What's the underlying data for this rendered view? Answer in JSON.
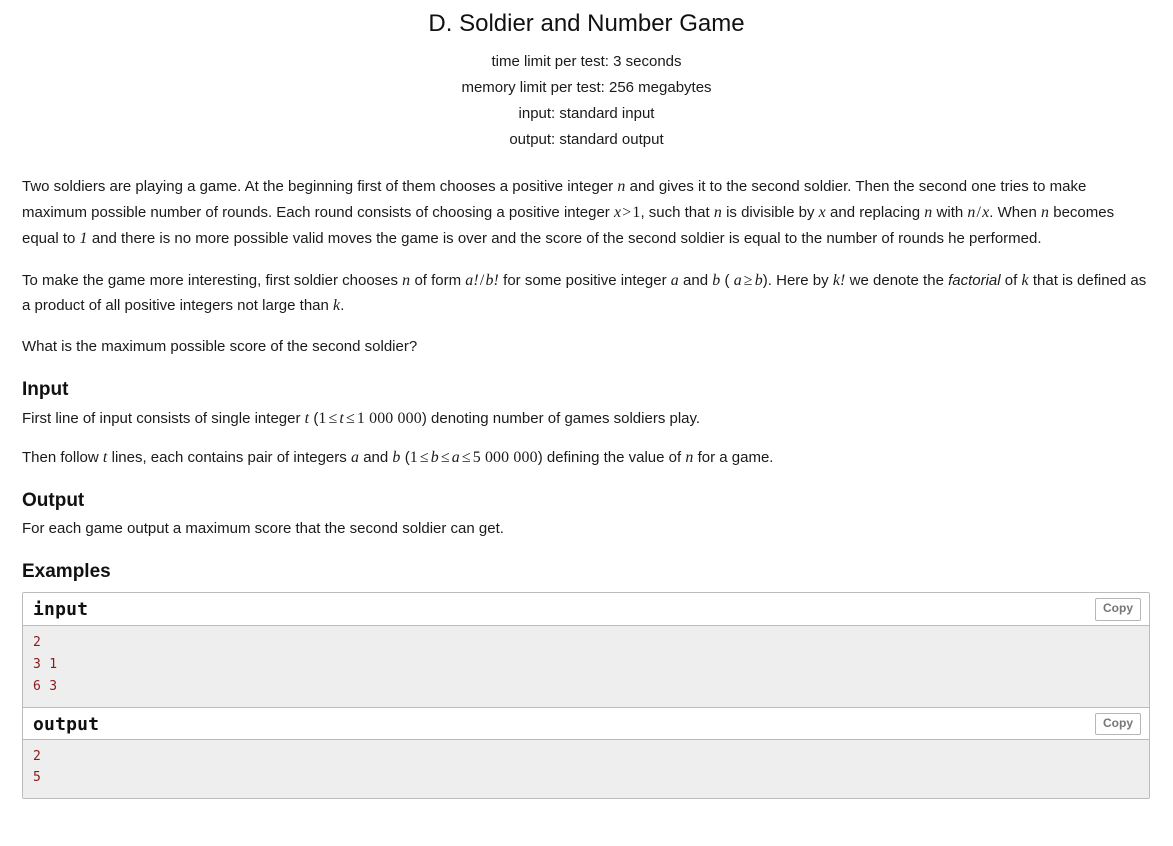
{
  "header": {
    "title": "D. Soldier and Number Game",
    "time_limit": "time limit per test: 3 seconds",
    "memory_limit": "memory limit per test: 256 megabytes",
    "input_spec": "input: standard input",
    "output_spec": "output: standard output"
  },
  "legend": {
    "p1": {
      "t1": "Two soldiers are playing a game. At the beginning first of them chooses a positive integer ",
      "m1": "n",
      "t2": " and gives it to the second soldier. Then the second one tries to make maximum possible number of rounds. Each round consists of choosing a positive integer ",
      "m2_var": "x",
      "m2_op": ">",
      "m2_num": "1",
      "t3": ", such that ",
      "m3": "n",
      "t4": " is divisible by ",
      "m4": "x",
      "t5": " and replacing ",
      "m5": "n",
      "t6": " with ",
      "m6_a": "n",
      "m6_slash": "/",
      "m6_b": "x",
      "t7": ". When ",
      "m7": "n",
      "t8": " becomes equal to ",
      "m8": "1",
      "t9": " and there is no more possible valid moves the game is over and the score of the second soldier is equal to the number of rounds he performed."
    },
    "p2": {
      "t1": "To make the game more interesting, first soldier chooses ",
      "m1": "n",
      "t2": " of form ",
      "m2": "a!",
      "m2_slash": "/",
      "m2b": "b!",
      "t3": " for some positive integer ",
      "m3": "a",
      "t4": " and ",
      "m4": "b",
      "t5": " ( ",
      "m5_a": "a",
      "m5_rel": "≥",
      "m5_b": "b",
      "t6": "). Here by ",
      "m6": "k!",
      "t7": " we denote the ",
      "emph": "factorial",
      "t8": " of ",
      "m7": "k",
      "t9": " that is defined as a product of all positive integers not large than ",
      "m8": "k",
      "t10": "."
    },
    "p3": "What is the maximum possible score of the second soldier?"
  },
  "input_section": {
    "title": "Input",
    "p1": {
      "t1": "First line of input consists of single integer ",
      "m1": "t",
      "t2": " (",
      "m2_lo": "1",
      "m2_rel1": "≤",
      "m2_var": "t",
      "m2_rel2": "≤",
      "m2_hi": "1 000 000",
      "t3": ") denoting number of games soldiers play."
    },
    "p2": {
      "t1": "Then follow ",
      "m1": "t",
      "t2": " lines, each contains pair of integers ",
      "m2": "a",
      "t3": " and ",
      "m3": "b",
      "t4": " (",
      "m4_lo": "1",
      "m4_rel1": "≤",
      "m4_b": "b",
      "m4_rel2": "≤",
      "m4_a": "a",
      "m4_rel3": "≤",
      "m4_hi": "5 000 000",
      "t5": ") defining the value of ",
      "m5": "n",
      "t6": " for a game."
    }
  },
  "output_section": {
    "title": "Output",
    "p1": "For each game output a maximum score that the second soldier can get."
  },
  "examples_section": {
    "title": "Examples",
    "copy_label": "Copy",
    "samples": [
      {
        "label": "input",
        "text": "2\n3 1\n6 3"
      },
      {
        "label": "output",
        "text": "2\n5"
      }
    ]
  }
}
